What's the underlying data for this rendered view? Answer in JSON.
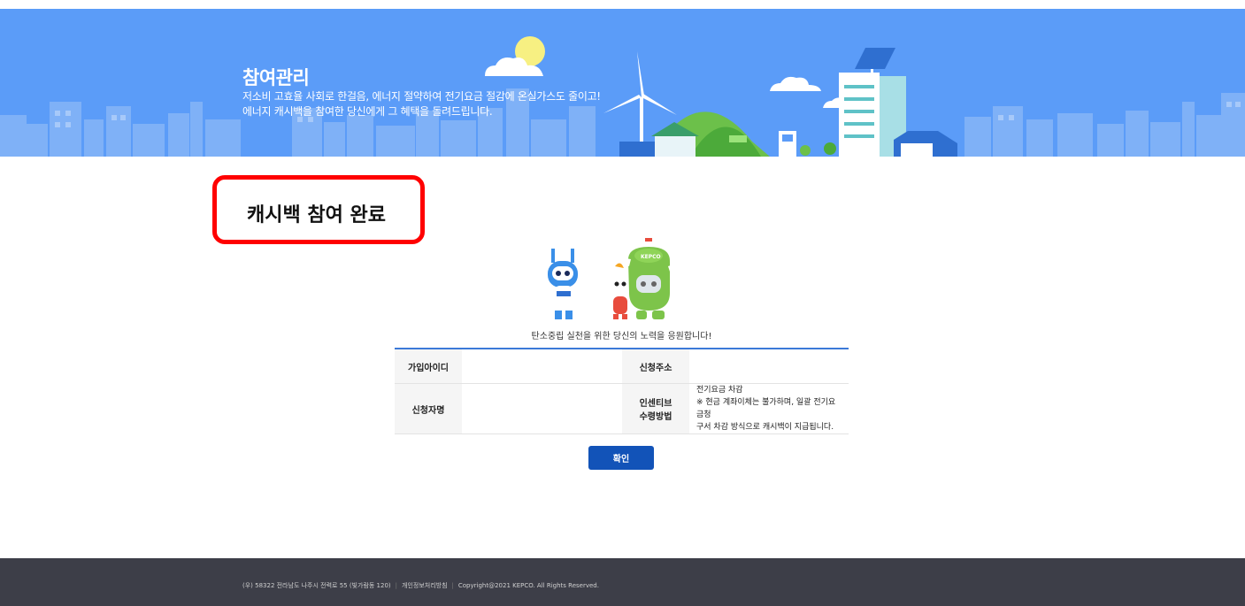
{
  "banner": {
    "title": "참여관리",
    "desc_line1": "저소비 고효율 사회로 한걸음, 에너지 절약하여 전기요금 절감에 온실가스도 줄이고!",
    "desc_line2": "에너지 캐시백을 참여한 당신에게 그 혜택을 돌려드립니다."
  },
  "page": {
    "title": "캐시백 참여 완료",
    "cheer": "탄소중립 실천을 위한 당신의 노력을 응원합니다!"
  },
  "table": {
    "row1": {
      "label1": "가입아이디",
      "value1": "",
      "label2": "신청주소",
      "value2": ""
    },
    "row2": {
      "label1": "신청자명",
      "value1": "",
      "label2_line1": "인센티브",
      "label2_line2": "수령방법",
      "note_line1": "전기요금 차감",
      "note_line2": "※ 현금 계좌이체는 불가하며, 일괄 전기요금청",
      "note_line3": "구서 차감 방식으로 캐시백이 지급됩니다."
    }
  },
  "confirm_label": "확인",
  "footer": {
    "address": "(우) 58322 전라남도 나주시 전력로 55 (빛가람동 120)",
    "privacy": "개인정보처리방침",
    "copyright": "Copyright@2021 KEPCO. All Rights Reserved."
  },
  "mascot_logo": "KEPCO",
  "colors": {
    "banner": "#5b9cf8",
    "accent": "#1253b8",
    "highlight": "#ff0000",
    "footer": "#3d3e48"
  }
}
